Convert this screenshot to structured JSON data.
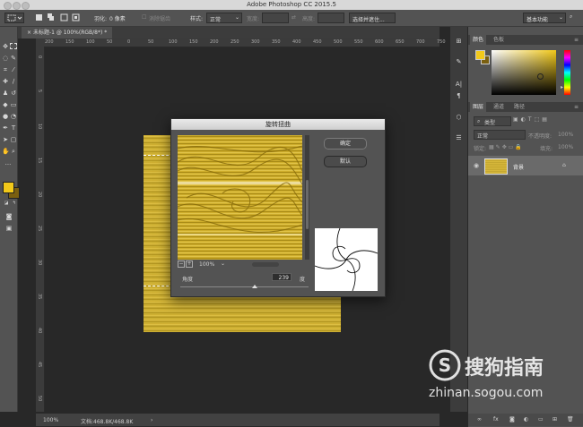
{
  "app": {
    "title": "Adobe Photoshop CC 2015.5"
  },
  "options_bar": {
    "feather_label": "羽化:",
    "feather_value": "0 像素",
    "antialias_label": "消除锯齿",
    "style_label": "样式:",
    "style_value": "正常",
    "width_label": "宽度:",
    "height_label": "高度:",
    "select_mask_button": "选择并遮住...",
    "workspace": "基本功能"
  },
  "document_tab": {
    "label": "未标题-1 @ 100%(RGB/8*) *"
  },
  "ruler_top": [
    "200",
    "150",
    "100",
    "50",
    "0",
    "50",
    "100",
    "150",
    "200",
    "250",
    "300",
    "350",
    "400",
    "450",
    "500",
    "550",
    "600",
    "650",
    "700",
    "750"
  ],
  "ruler_left": [
    "0",
    "5",
    "10",
    "15",
    "20",
    "25",
    "30",
    "35",
    "40",
    "45",
    "50"
  ],
  "dialog": {
    "title": "旋转扭曲",
    "ok_button": "确定",
    "default_button": "默认",
    "zoom_value": "100%",
    "angle_label": "角度",
    "angle_value": "239",
    "angle_unit": "度",
    "angle_fraction": 0.58
  },
  "status_bar": {
    "zoom": "100%",
    "doc_info": "文档:468.8K/468.8K"
  },
  "color_panel": {
    "tab_color": "颜色",
    "tab_swatches": "色板",
    "foreground": "#f2c91a",
    "background": "#7a5f10",
    "picker_hue": "#f2c91a"
  },
  "layers_panel": {
    "tab_layers": "图层",
    "tab_channels": "通道",
    "tab_paths": "路径",
    "filter_kind": "类型",
    "blend_mode": "正常",
    "opacity_label": "不透明度:",
    "opacity_value": "100%",
    "lock_label": "锁定:",
    "fill_label": "填充:",
    "fill_value": "100%",
    "layer_name": "背景"
  },
  "watermark": {
    "brand": "搜狗指南",
    "url": "zhinan.sogou.com"
  }
}
